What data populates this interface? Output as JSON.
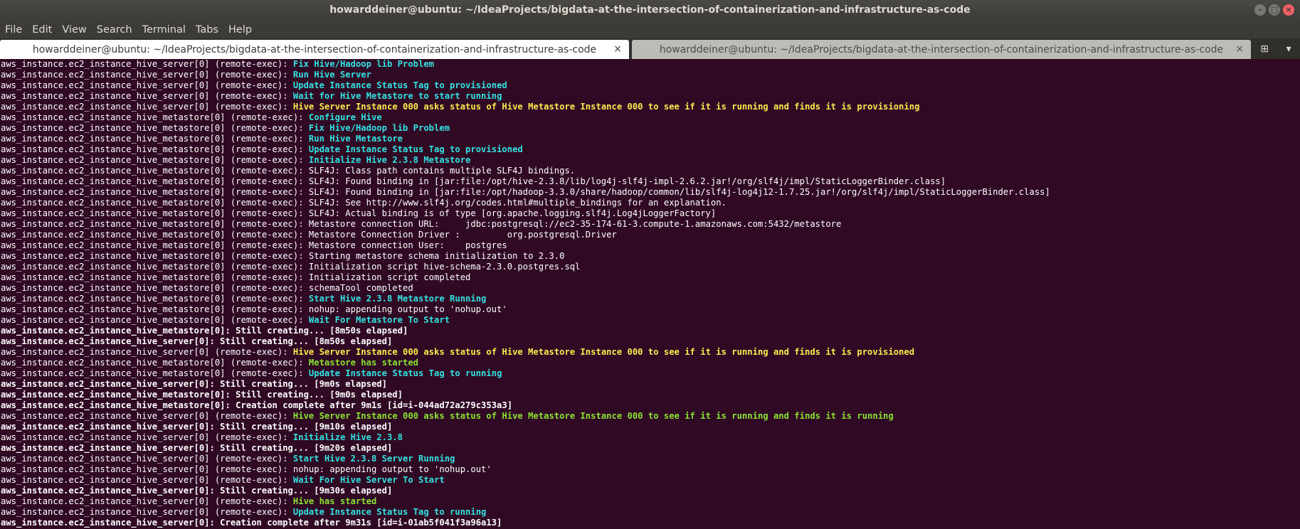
{
  "window": {
    "title": "howarddeiner@ubuntu: ~/IdeaProjects/bigdata-at-the-intersection-of-containerization-and-infrastructure-as-code",
    "controls": {
      "minimize": "–",
      "maximize": "□",
      "close": "×"
    }
  },
  "menu": [
    "File",
    "Edit",
    "View",
    "Search",
    "Terminal",
    "Tabs",
    "Help"
  ],
  "tabs": [
    {
      "label": "howarddeiner@ubuntu: ~/IdeaProjects/bigdata-at-the-intersection-of-containerization-and-infrastructure-as-code",
      "close": "×",
      "active": true
    },
    {
      "label": "howarddeiner@ubuntu: ~/IdeaProjects/bigdata-at-the-intersection-of-containerization-and-infrastructure-as-code",
      "close": "×",
      "active": false
    }
  ],
  "tab_tools": {
    "new_tab_icon": "new-tab-icon",
    "new_tab_glyph": "⊞",
    "menu_glyph": "▾"
  },
  "colors": {
    "background": "#300a24",
    "cyan": "#34e2e2",
    "yellow": "#fce94f",
    "green": "#8ae234",
    "text": "#ffffff"
  },
  "lines": [
    [
      {
        "t": "aws_instance.ec2_instance_hive_server[0] (remote-exec): "
      },
      {
        "t": "Fix Hive/Hadoop lib Problem",
        "c": "cyan"
      }
    ],
    [
      {
        "t": "aws_instance.ec2_instance_hive_server[0] (remote-exec): "
      },
      {
        "t": "Run Hive Server",
        "c": "cyan"
      }
    ],
    [
      {
        "t": "aws_instance.ec2_instance_hive_server[0] (remote-exec): "
      },
      {
        "t": "Update Instance Status Tag to provisioned",
        "c": "cyan"
      }
    ],
    [
      {
        "t": "aws_instance.ec2_instance_hive_server[0] (remote-exec): "
      },
      {
        "t": "Wait for Hive Metastore to start running",
        "c": "cyan"
      }
    ],
    [
      {
        "t": "aws_instance.ec2_instance_hive_server[0] (remote-exec): "
      },
      {
        "t": "Hive Server Instance 000 asks status of Hive Metastore Instance 000 to see if it is running and finds it is provisioning",
        "c": "yellow"
      }
    ],
    [
      {
        "t": "aws_instance.ec2_instance_hive_metastore[0] (remote-exec): "
      },
      {
        "t": "Configure Hive",
        "c": "cyan"
      }
    ],
    [
      {
        "t": "aws_instance.ec2_instance_hive_metastore[0] (remote-exec): "
      },
      {
        "t": "Fix Hive/Hadoop lib Problem",
        "c": "cyan"
      }
    ],
    [
      {
        "t": "aws_instance.ec2_instance_hive_metastore[0] (remote-exec): "
      },
      {
        "t": "Run Hive Metastore",
        "c": "cyan"
      }
    ],
    [
      {
        "t": "aws_instance.ec2_instance_hive_metastore[0] (remote-exec): "
      },
      {
        "t": "Update Instance Status Tag to provisioned",
        "c": "cyan"
      }
    ],
    [
      {
        "t": "aws_instance.ec2_instance_hive_metastore[0] (remote-exec): "
      },
      {
        "t": "Initialize Hive 2.3.8 Metastore",
        "c": "cyan"
      }
    ],
    [
      {
        "t": "aws_instance.ec2_instance_hive_metastore[0] (remote-exec): SLF4J: Class path contains multiple SLF4J bindings."
      }
    ],
    [
      {
        "t": "aws_instance.ec2_instance_hive_metastore[0] (remote-exec): SLF4J: Found binding in [jar:file:/opt/hive-2.3.8/lib/log4j-slf4j-impl-2.6.2.jar!/org/slf4j/impl/StaticLoggerBinder.class]"
      }
    ],
    [
      {
        "t": "aws_instance.ec2_instance_hive_metastore[0] (remote-exec): SLF4J: Found binding in [jar:file:/opt/hadoop-3.3.0/share/hadoop/common/lib/slf4j-log4j12-1.7.25.jar!/org/slf4j/impl/StaticLoggerBinder.class]"
      }
    ],
    [
      {
        "t": "aws_instance.ec2_instance_hive_metastore[0] (remote-exec): SLF4J: See http://www.slf4j.org/codes.html#multiple_bindings for an explanation."
      }
    ],
    [
      {
        "t": "aws_instance.ec2_instance_hive_metastore[0] (remote-exec): SLF4J: Actual binding is of type [org.apache.logging.slf4j.Log4jLoggerFactory]"
      }
    ],
    [
      {
        "t": "aws_instance.ec2_instance_hive_metastore[0] (remote-exec): Metastore connection URL:\t jdbc:postgresql://ec2-35-174-61-3.compute-1.amazonaws.com:5432/metastore"
      }
    ],
    [
      {
        "t": "aws_instance.ec2_instance_hive_metastore[0] (remote-exec): Metastore Connection Driver :\t org.postgresql.Driver"
      }
    ],
    [
      {
        "t": "aws_instance.ec2_instance_hive_metastore[0] (remote-exec): Metastore connection User:\t postgres"
      }
    ],
    [
      {
        "t": "aws_instance.ec2_instance_hive_metastore[0] (remote-exec): Starting metastore schema initialization to 2.3.0"
      }
    ],
    [
      {
        "t": "aws_instance.ec2_instance_hive_metastore[0] (remote-exec): Initialization script hive-schema-2.3.0.postgres.sql"
      }
    ],
    [
      {
        "t": "aws_instance.ec2_instance_hive_metastore[0] (remote-exec): Initialization script completed"
      }
    ],
    [
      {
        "t": "aws_instance.ec2_instance_hive_metastore[0] (remote-exec): schemaTool completed"
      }
    ],
    [
      {
        "t": "aws_instance.ec2_instance_hive_metastore[0] (remote-exec): "
      },
      {
        "t": "Start Hive 2.3.8 Metastore Running",
        "c": "cyan"
      }
    ],
    [
      {
        "t": "aws_instance.ec2_instance_hive_metastore[0] (remote-exec): nohup: appending output to 'nohup.out'"
      }
    ],
    [
      {
        "t": "aws_instance.ec2_instance_hive_metastore[0] (remote-exec): "
      },
      {
        "t": "Wait For Metastore To Start",
        "c": "cyan"
      }
    ],
    [
      {
        "t": "aws_instance.ec2_instance_hive_metastore[0]: Still creating... [8m50s elapsed]",
        "c": "bold"
      }
    ],
    [
      {
        "t": "aws_instance.ec2_instance_hive_server[0]: Still creating... [8m50s elapsed]",
        "c": "bold"
      }
    ],
    [
      {
        "t": "aws_instance.ec2_instance_hive_server[0] (remote-exec): "
      },
      {
        "t": "Hive Server Instance 000 asks status of Hive Metastore Instance 000 to see if it is running and finds it is provisioned",
        "c": "yellow"
      }
    ],
    [
      {
        "t": "aws_instance.ec2_instance_hive_metastore[0] (remote-exec): "
      },
      {
        "t": "Metastore has started",
        "c": "green"
      }
    ],
    [
      {
        "t": "aws_instance.ec2_instance_hive_metastore[0] (remote-exec): "
      },
      {
        "t": "Update Instance Status Tag to running",
        "c": "cyan"
      }
    ],
    [
      {
        "t": "aws_instance.ec2_instance_hive_server[0]: Still creating... [9m0s elapsed]",
        "c": "bold"
      }
    ],
    [
      {
        "t": "aws_instance.ec2_instance_hive_metastore[0]: Still creating... [9m0s elapsed]",
        "c": "bold"
      }
    ],
    [
      {
        "t": "aws_instance.ec2_instance_hive_metastore[0]: Creation complete after 9m1s [id=i-044ad72a279c353a3]",
        "c": "bold"
      }
    ],
    [
      {
        "t": "aws_instance.ec2_instance_hive_server[0] (remote-exec): "
      },
      {
        "t": "Hive Server Instance 000 asks status of Hive Metastore Instance 000 to see if it is running and finds it is running",
        "c": "green"
      }
    ],
    [
      {
        "t": "aws_instance.ec2_instance_hive_server[0]: Still creating... [9m10s elapsed]",
        "c": "bold"
      }
    ],
    [
      {
        "t": "aws_instance.ec2_instance_hive_server[0] (remote-exec): "
      },
      {
        "t": "Initialize Hive 2.3.8",
        "c": "cyan"
      }
    ],
    [
      {
        "t": "aws_instance.ec2_instance_hive_server[0]: Still creating... [9m20s elapsed]",
        "c": "bold"
      }
    ],
    [
      {
        "t": "aws_instance.ec2_instance_hive_server[0] (remote-exec): "
      },
      {
        "t": "Start Hive 2.3.8 Server Running",
        "c": "cyan"
      }
    ],
    [
      {
        "t": "aws_instance.ec2_instance_hive_server[0] (remote-exec): nohup: appending output to 'nohup.out'"
      }
    ],
    [
      {
        "t": "aws_instance.ec2_instance_hive_server[0] (remote-exec): "
      },
      {
        "t": "Wait For Hive Server To Start",
        "c": "cyan"
      }
    ],
    [
      {
        "t": "aws_instance.ec2_instance_hive_server[0]: Still creating... [9m30s elapsed]",
        "c": "bold"
      }
    ],
    [
      {
        "t": "aws_instance.ec2_instance_hive_server[0] (remote-exec): "
      },
      {
        "t": "Hive has started",
        "c": "green"
      }
    ],
    [
      {
        "t": "aws_instance.ec2_instance_hive_server[0] (remote-exec): "
      },
      {
        "t": "Update Instance Status Tag to running",
        "c": "cyan"
      }
    ],
    [
      {
        "t": "aws_instance.ec2_instance_hive_server[0]: Creation complete after 9m31s [id=i-01ab5f041f3a96a13]",
        "c": "bold"
      }
    ]
  ]
}
